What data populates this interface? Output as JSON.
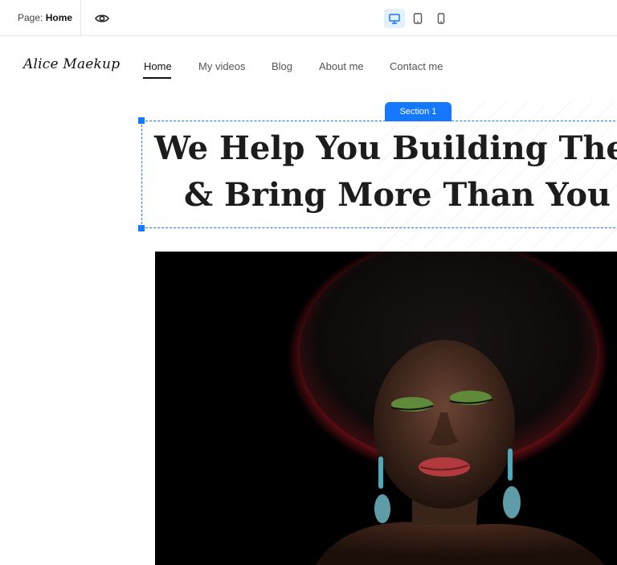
{
  "editor": {
    "page_prefix": "Page: ",
    "page_name": "Home",
    "preview_icon": "eye-icon",
    "devices": [
      {
        "name": "desktop",
        "icon": "desktop-icon",
        "active": true
      },
      {
        "name": "tablet",
        "icon": "tablet-icon",
        "active": false
      },
      {
        "name": "mobile",
        "icon": "mobile-icon",
        "active": false
      }
    ],
    "accent": "#1677ff"
  },
  "site": {
    "logo": "Alice Maekup",
    "nav": [
      "Home",
      "My videos",
      "Blog",
      "About me",
      "Contact me"
    ],
    "active_nav": "Home",
    "section_tag": "Section 1",
    "headline_line1": "We Help You Building The Dre",
    "headline_line2": "& Bring More Than You Expe",
    "hero_image": "Portrait of a woman with dark curly hair, green glitter eyeshadow and teal drop earrings against a black background"
  }
}
